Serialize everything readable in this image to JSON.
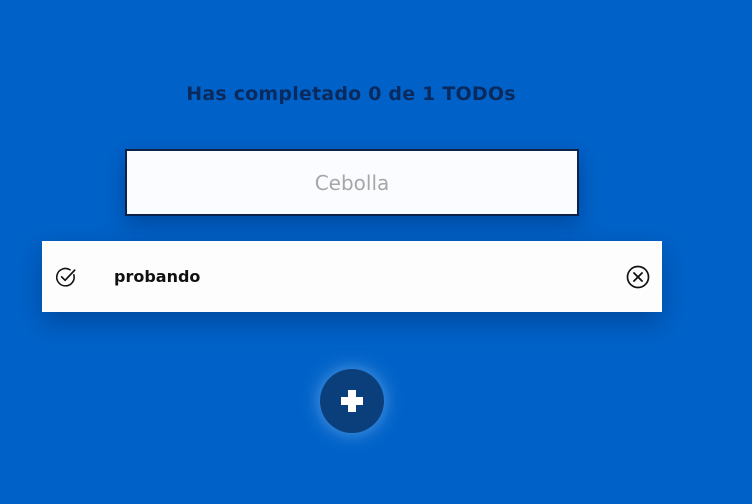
{
  "header": {
    "counter_text": "Has completado 0 de 1 TODOs"
  },
  "search": {
    "value": "",
    "placeholder": "Cebolla"
  },
  "todos": [
    {
      "text": "probando",
      "completed": false,
      "check_icon": "check-circle-icon",
      "delete_icon": "close-circle-icon"
    }
  ],
  "add_button": {
    "icon": "plus-icon"
  },
  "colors": {
    "background": "#0062c8",
    "title": "#0a2a5e",
    "add_button": "#0b3f7c"
  }
}
